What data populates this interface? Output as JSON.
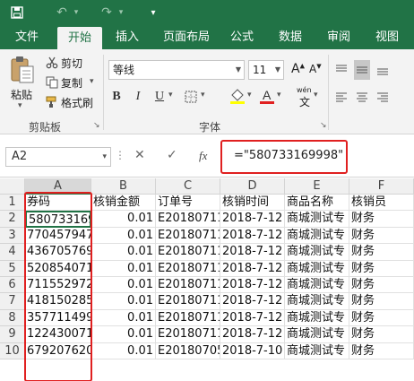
{
  "ribbon_tabs": [
    "文件",
    "开始",
    "插入",
    "页面布局",
    "公式",
    "数据",
    "审阅",
    "视图"
  ],
  "active_tab": "开始",
  "clipboard": {
    "paste_label": "粘贴",
    "cut_label": "剪切",
    "copy_label": "复制",
    "format_painter_label": "格式刷",
    "group_label": "剪贴板"
  },
  "font": {
    "name": "等线",
    "size": "11",
    "group_label": "字体",
    "phonetic_label": "wén"
  },
  "name_box": "A2",
  "formula_bar": {
    "fx_label": "fx",
    "value": "=\"580733169998\""
  },
  "columns": [
    "A",
    "B",
    "C",
    "D",
    "E",
    "F"
  ],
  "rows": [
    [
      "券码",
      "核销金额",
      "订单号",
      "核销时间",
      "商品名称",
      "核销员"
    ],
    [
      "580733169",
      "0.01",
      "E20180711",
      "2018-7-12",
      "商城测试专",
      "财务"
    ],
    [
      "770457947",
      "0.01",
      "E20180711",
      "2018-7-12",
      "商城测试专",
      "财务"
    ],
    [
      "436705769",
      "0.01",
      "E20180711",
      "2018-7-12",
      "商城测试专",
      "财务"
    ],
    [
      "520854071",
      "0.01",
      "E20180711",
      "2018-7-12",
      "商城测试专",
      "财务"
    ],
    [
      "711552972",
      "0.01",
      "E20180711",
      "2018-7-12",
      "商城测试专",
      "财务"
    ],
    [
      "418150285",
      "0.01",
      "E20180711",
      "2018-7-12",
      "商城测试专",
      "财务"
    ],
    [
      "357711499",
      "0.01",
      "E20180711",
      "2018-7-12",
      "商城测试专",
      "财务"
    ],
    [
      "122430071",
      "0.01",
      "E20180711",
      "2018-7-12",
      "商城测试专",
      "财务"
    ],
    [
      "679207620",
      "0.01",
      "E20180705",
      "2018-7-10",
      "商城测试专",
      "财务"
    ]
  ],
  "colors": {
    "excel_green": "#217346",
    "highlight_red": "#e02020"
  }
}
